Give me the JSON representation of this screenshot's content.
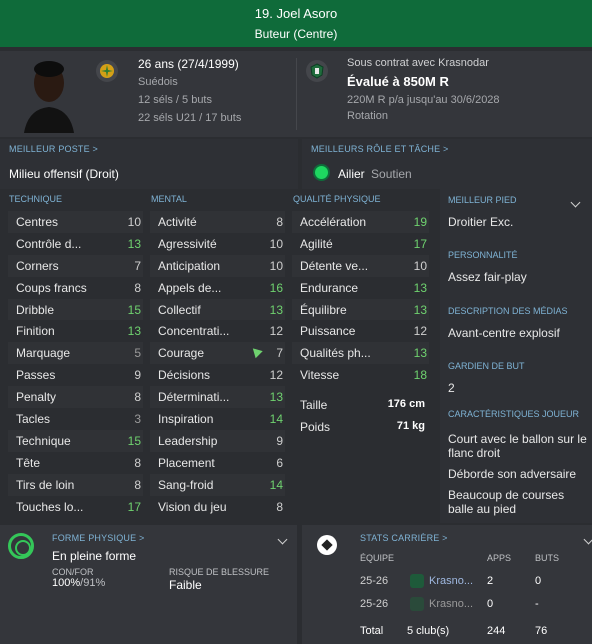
{
  "header": {
    "name": "19. Joel Asoro",
    "role": "Buteur (Centre)"
  },
  "bio": {
    "age": "26 ans (27/4/1999)",
    "nationality": "Suédois",
    "caps": "12 séls / 5 buts",
    "u21": "22 séls U21 / 17 buts"
  },
  "contract": {
    "line1": "Sous contrat avec Krasnodar",
    "value": "Évalué à 850M R",
    "wage": "220M R p/a jusqu'au 30/6/2028",
    "status": "Rotation"
  },
  "best_position": {
    "label": "MEILLEUR POSTE >",
    "value": "Milieu offensif (Droit)"
  },
  "best_role": {
    "label": "MEILLEURS RÔLE ET TÂCHE >",
    "role": "Ailier",
    "duty": "Soutien"
  },
  "headers": {
    "technique": "TECHNIQUE",
    "mental": "MENTAL",
    "physique": "QUALITÉ PHYSIQUE"
  },
  "technique": [
    {
      "name": "Centres",
      "value": "10"
    },
    {
      "name": "Contrôle d...",
      "value": "13"
    },
    {
      "name": "Corners",
      "value": "7"
    },
    {
      "name": "Coups francs",
      "value": "8"
    },
    {
      "name": "Dribble",
      "value": "15"
    },
    {
      "name": "Finition",
      "value": "13"
    },
    {
      "name": "Marquage",
      "value": "5"
    },
    {
      "name": "Passes",
      "value": "9"
    },
    {
      "name": "Penalty",
      "value": "8"
    },
    {
      "name": "Tacles",
      "value": "3"
    },
    {
      "name": "Technique",
      "value": "15"
    },
    {
      "name": "Tête",
      "value": "8"
    },
    {
      "name": "Tirs de loin",
      "value": "8"
    },
    {
      "name": "Touches lo...",
      "value": "17"
    }
  ],
  "mental": [
    {
      "name": "Activité",
      "value": "8"
    },
    {
      "name": "Agressivité",
      "value": "10"
    },
    {
      "name": "Anticipation",
      "value": "10"
    },
    {
      "name": "Appels de...",
      "value": "16"
    },
    {
      "name": "Collectif",
      "value": "13"
    },
    {
      "name": "Concentrati...",
      "value": "12"
    },
    {
      "name": "Courage",
      "value": "7"
    },
    {
      "name": "Décisions",
      "value": "12"
    },
    {
      "name": "Déterminati...",
      "value": "13"
    },
    {
      "name": "Inspiration",
      "value": "14"
    },
    {
      "name": "Leadership",
      "value": "9"
    },
    {
      "name": "Placement",
      "value": "6"
    },
    {
      "name": "Sang-froid",
      "value": "14"
    },
    {
      "name": "Vision du jeu",
      "value": "8"
    }
  ],
  "physique": [
    {
      "name": "Accélération",
      "value": "19"
    },
    {
      "name": "Agilité",
      "value": "17"
    },
    {
      "name": "Détente ve...",
      "value": "10"
    },
    {
      "name": "Endurance",
      "value": "13"
    },
    {
      "name": "Équilibre",
      "value": "13"
    },
    {
      "name": "Puissance",
      "value": "12"
    },
    {
      "name": "Qualités ph...",
      "value": "13"
    },
    {
      "name": "Vitesse",
      "value": "18"
    }
  ],
  "physical_extra": [
    {
      "name": "Taille",
      "value": "176 cm"
    },
    {
      "name": "Poids",
      "value": "71 kg"
    }
  ],
  "right": {
    "best_foot_label": "MEILLEUR PIED",
    "best_foot": "Droitier Exc.",
    "personality_label": "PERSONNALITÉ",
    "personality": "Assez fair-play",
    "media_label": "DESCRIPTION DES MÉDIAS",
    "media": "Avant-centre explosif",
    "gk_label": "GARDIEN DE BUT",
    "gk": "2",
    "traits_label": "CARACTÉRISTIQUES JOUEUR",
    "traits": [
      "Court avec le ballon sur le flanc droit",
      "Déborde son adversaire",
      "Beaucoup de courses balle au pied"
    ]
  },
  "form": {
    "label": "FORME PHYSIQUE >",
    "value": "En pleine forme",
    "confor_label": "CON/FOR",
    "confor_value": "100%",
    "confor_value2": "91%",
    "risk_label": "RISQUE DE BLESSURE",
    "risk_value": "Faible"
  },
  "career": {
    "label": "STATS CARRIÈRE >",
    "headers": {
      "team": "ÉQUIPE",
      "apps": "APPS",
      "goals": "BUTS"
    },
    "rows": [
      {
        "season": "25-26",
        "team": "Krasno...",
        "apps": "2",
        "goals": "0"
      },
      {
        "season": "25-26",
        "team": "Krasno...",
        "apps": "0",
        "goals": "-"
      }
    ],
    "total": {
      "label": "Total",
      "clubs": "5 club(s)",
      "apps": "244",
      "goals": "76"
    }
  },
  "colors": {
    "header_green": "#0f6b3a",
    "high_value": "#6fd26f",
    "section_label": "#7fb3d5"
  }
}
